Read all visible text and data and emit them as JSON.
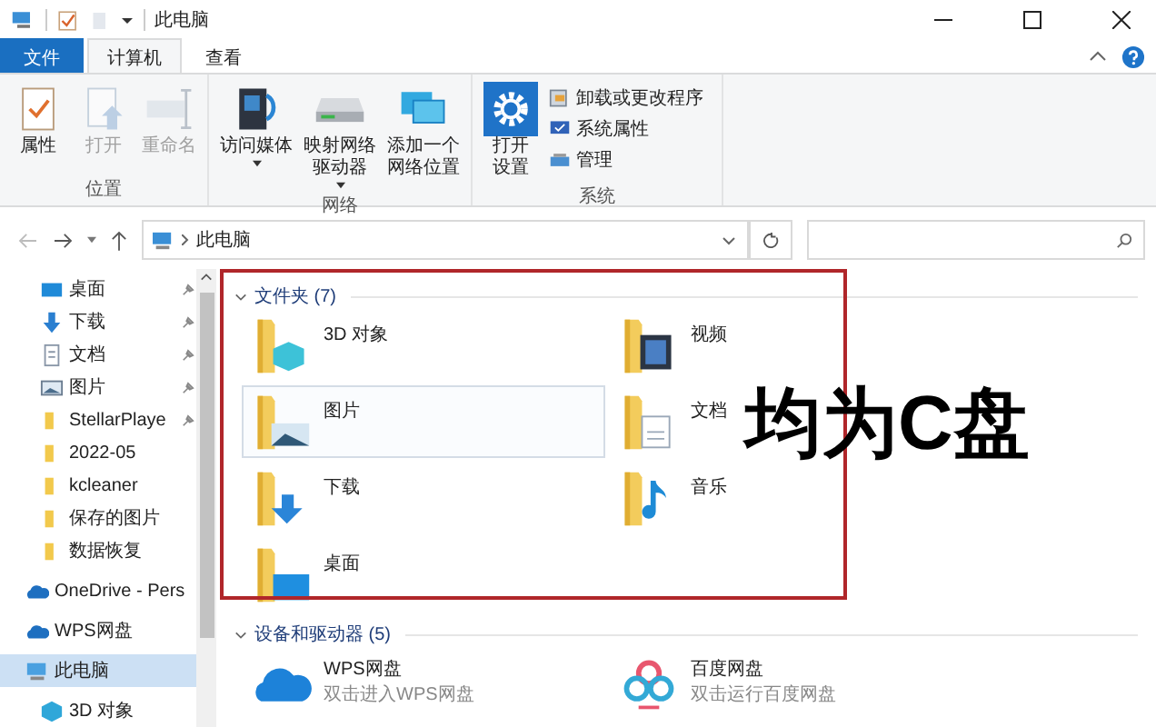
{
  "window": {
    "title": "此电脑"
  },
  "tabs": [
    {
      "label": "文件",
      "kind": "file",
      "selected": false
    },
    {
      "label": "计算机",
      "kind": "tab",
      "selected": true
    },
    {
      "label": "查看",
      "kind": "tab",
      "selected": false
    }
  ],
  "ribbon_groups": [
    {
      "label": "位置",
      "items": [
        {
          "kind": "properties",
          "lines": [
            "属性"
          ],
          "disabled": false,
          "dropdown": false
        },
        {
          "kind": "open",
          "lines": [
            "打开"
          ],
          "disabled": true,
          "dropdown": false
        },
        {
          "kind": "rename",
          "lines": [
            "重命名"
          ],
          "disabled": true,
          "dropdown": false
        }
      ]
    },
    {
      "label": "网络",
      "items": [
        {
          "kind": "media",
          "lines": [
            "访问媒体"
          ],
          "disabled": false,
          "dropdown": true
        },
        {
          "kind": "drive",
          "lines": [
            "映射网络",
            "驱动器"
          ],
          "disabled": false,
          "dropdown": true
        },
        {
          "kind": "network",
          "lines": [
            "添加一个",
            "网络位置"
          ],
          "disabled": false,
          "dropdown": false
        }
      ]
    },
    {
      "label": "系统",
      "items": [
        {
          "kind": "settings",
          "lines": [
            "打开",
            "设置"
          ],
          "disabled": false,
          "dropdown": false
        }
      ],
      "small_items": [
        {
          "kind": "uninstall",
          "label": "卸载或更改程序"
        },
        {
          "kind": "sysprops",
          "label": "系统属性"
        },
        {
          "kind": "manage",
          "label": "管理"
        }
      ]
    }
  ],
  "address": {
    "path": "此电脑"
  },
  "nav": [
    {
      "label": "桌面",
      "kind": "desktop",
      "pinned": true,
      "selected": false
    },
    {
      "label": "下载",
      "kind": "download",
      "pinned": true,
      "selected": false
    },
    {
      "label": "文档",
      "kind": "document",
      "pinned": true,
      "selected": false
    },
    {
      "label": "图片",
      "kind": "picture",
      "pinned": true,
      "selected": false
    },
    {
      "label": "StellarPlaye",
      "kind": "folder",
      "pinned": true,
      "selected": false
    },
    {
      "label": "2022-05",
      "kind": "folder",
      "pinned": false,
      "selected": false
    },
    {
      "label": "kcleaner",
      "kind": "folder",
      "pinned": false,
      "selected": false
    },
    {
      "label": "保存的图片",
      "kind": "folder",
      "pinned": false,
      "selected": false
    },
    {
      "label": "数据恢复",
      "kind": "folder",
      "pinned": false,
      "selected": false
    },
    {
      "label": "OneDrive - Pers",
      "kind": "onedrive",
      "pinned": false,
      "selected": false
    },
    {
      "label": "WPS网盘",
      "kind": "wps",
      "pinned": false,
      "selected": false
    },
    {
      "label": "此电脑",
      "kind": "pc",
      "pinned": false,
      "selected": true
    },
    {
      "label": "3D 对象",
      "kind": "cube",
      "pinned": false,
      "selected": false
    }
  ],
  "folders_section": {
    "title": "文件夹 (7)",
    "expanded": true,
    "items": [
      {
        "label": "3D 对象",
        "kind": "cube",
        "selected": false
      },
      {
        "label": "视频",
        "kind": "video",
        "selected": false
      },
      {
        "label": "图片",
        "kind": "picture",
        "selected": true
      },
      {
        "label": "文档",
        "kind": "document",
        "selected": false
      },
      {
        "label": "下载",
        "kind": "download",
        "selected": false
      },
      {
        "label": "音乐",
        "kind": "music",
        "selected": false
      },
      {
        "label": "桌面",
        "kind": "desktop",
        "selected": false
      }
    ]
  },
  "drives_section": {
    "title": "设备和驱动器 (5)",
    "expanded": true,
    "items": [
      {
        "label": "WPS网盘",
        "subtitle": "双击进入WPS网盘",
        "kind": "wps"
      },
      {
        "label": "百度网盘",
        "subtitle": "双击运行百度网盘",
        "kind": "baidu"
      }
    ]
  },
  "annotation": {
    "text": "均为C盘"
  }
}
